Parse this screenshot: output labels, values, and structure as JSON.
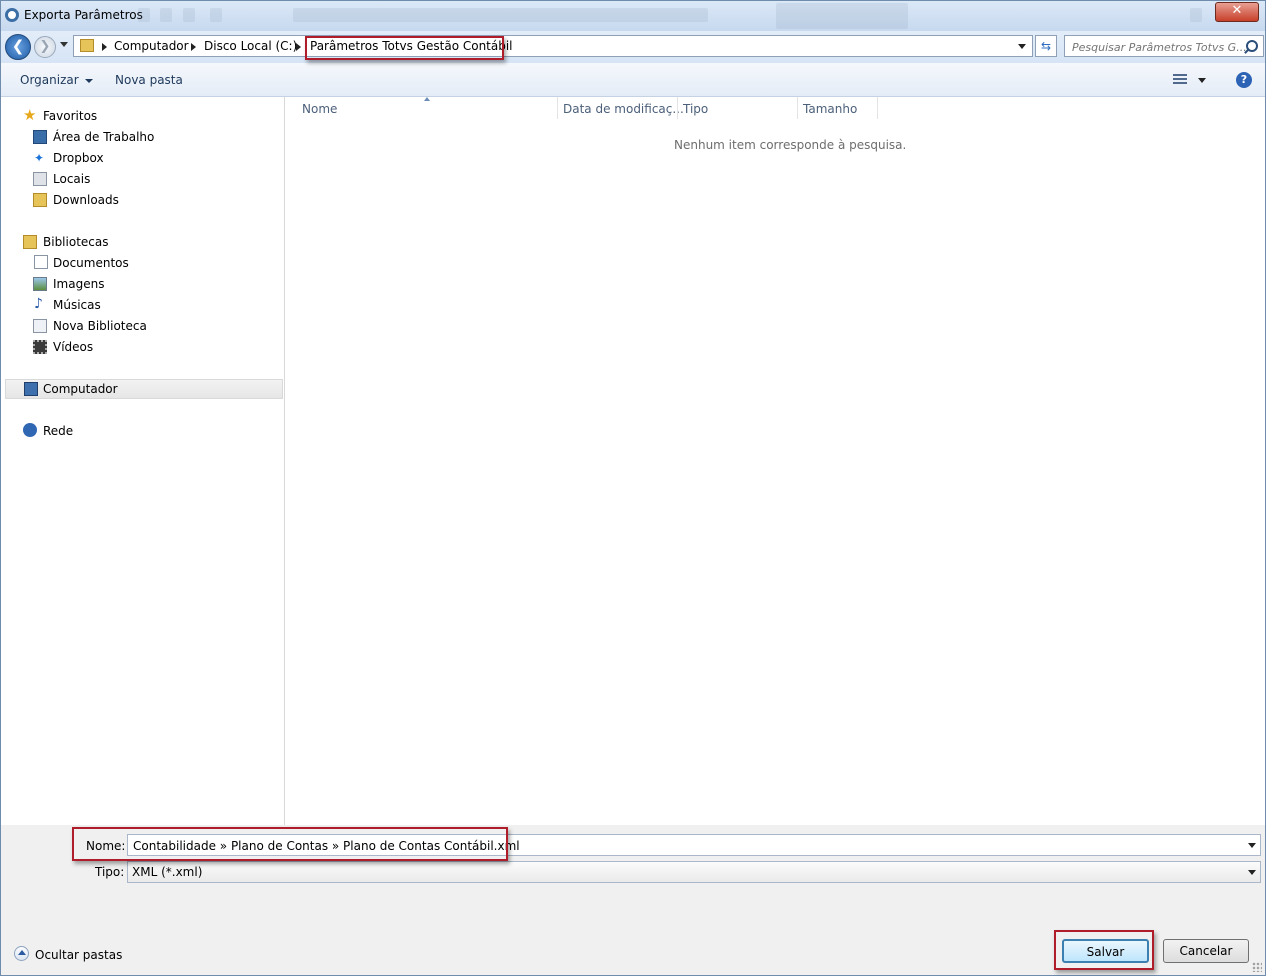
{
  "window": {
    "title": "Exporta Parâmetros",
    "close_glyph": "✕"
  },
  "nav": {
    "back_glyph": "❮",
    "forward_glyph": "❯",
    "breadcrumbs": [
      "Computador",
      "Disco Local (C:)",
      "Parâmetros Totvs Gestão Contábil"
    ],
    "refresh_glyph": "⇆",
    "search_placeholder": "Pesquisar Parâmetros Totvs G..."
  },
  "toolbar": {
    "organize": "Organizar",
    "new_folder": "Nova pasta",
    "help_glyph": "?"
  },
  "sidebar": {
    "favorites": {
      "label": "Favoritos",
      "items": [
        "Área de Trabalho",
        "Dropbox",
        "Locais",
        "Downloads"
      ]
    },
    "libraries": {
      "label": "Bibliotecas",
      "items": [
        "Documentos",
        "Imagens",
        "Músicas",
        "Nova Biblioteca",
        "Vídeos"
      ]
    },
    "computer": "Computador",
    "network": "Rede"
  },
  "file_list": {
    "columns": [
      "Nome",
      "Data de modificaç...",
      "Tipo",
      "Tamanho"
    ],
    "empty_message": "Nenhum item corresponde à pesquisa."
  },
  "form": {
    "name_label": "Nome:",
    "name_value": "Contabilidade » Plano de Contas » Plano de Contas Contábil.xml",
    "type_label": "Tipo:",
    "type_value": "XML (*.xml)"
  },
  "footer": {
    "hide_folders": "Ocultar pastas",
    "save": "Salvar",
    "cancel": "Cancelar"
  },
  "colors": {
    "accent": "#3c7fb1",
    "highlight_box": "#b01d2a",
    "title_bar": "#c7d9ef"
  }
}
